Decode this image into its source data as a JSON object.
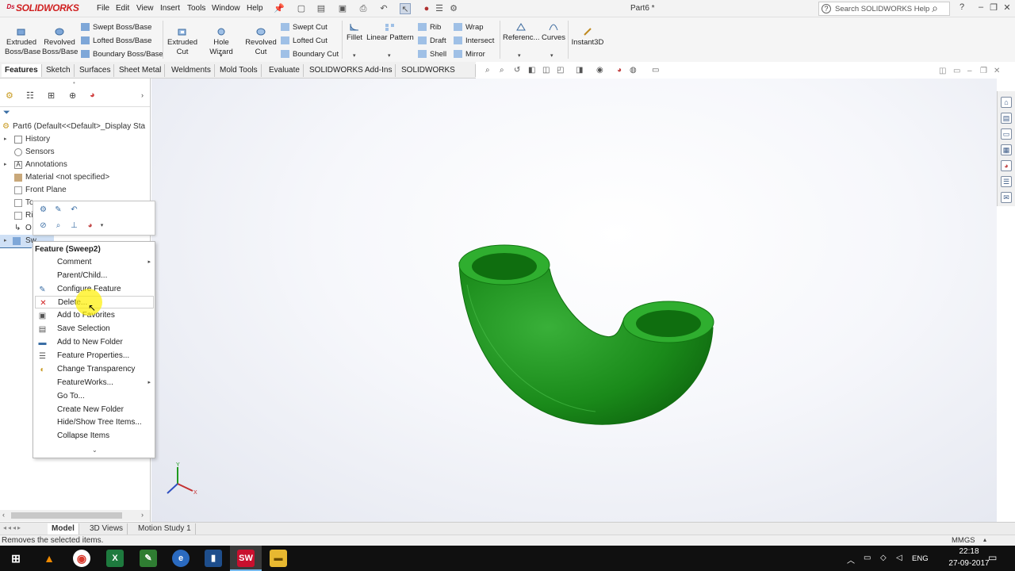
{
  "app": {
    "name": "SOLIDWORKS",
    "doc_title": "Part6 *"
  },
  "menu": [
    "File",
    "Edit",
    "View",
    "Insert",
    "Tools",
    "Window",
    "Help"
  ],
  "search": {
    "placeholder": "Search SOLIDWORKS Help"
  },
  "cmd": {
    "extruded_boss": "Extruded Boss/Base",
    "revolved_boss": "Revolved Boss/Base",
    "swept_boss": "Swept Boss/Base",
    "lofted_boss": "Lofted Boss/Base",
    "boundary_boss": "Boundary Boss/Base",
    "extruded_cut": "Extruded Cut",
    "hole_wizard": "Hole Wizard",
    "revolved_cut": "Revolved Cut",
    "swept_cut": "Swept Cut",
    "lofted_cut": "Lofted Cut",
    "boundary_cut": "Boundary Cut",
    "fillet": "Fillet",
    "linear_pattern": "Linear Pattern",
    "rib": "Rib",
    "draft": "Draft",
    "shell": "Shell",
    "wrap": "Wrap",
    "intersect": "Intersect",
    "mirror": "Mirror",
    "reference": "Referenc...",
    "curves": "Curves",
    "instant3d": "Instant3D"
  },
  "tabs": [
    "Features",
    "Sketch",
    "Surfaces",
    "Sheet Metal",
    "Weldments",
    "Mold Tools",
    "Evaluate",
    "SOLIDWORKS Add-Ins",
    "SOLIDWORKS MBD"
  ],
  "tree": {
    "part": "Part6  (Default<<Default>_Display Sta",
    "history": "History",
    "sensors": "Sensors",
    "annotations": "Annotations",
    "material": "Material <not specified>",
    "front_plane": "Front Plane",
    "top_plane_trunc": "To",
    "right_plane_trunc": "Ri",
    "origin_trunc": "O",
    "sweep_trunc": "Sw"
  },
  "context_menu": {
    "title": "Feature (Sweep2)",
    "items": [
      {
        "label": "Comment",
        "submenu": true
      },
      {
        "label": "Parent/Child..."
      },
      {
        "label": "Configure Feature"
      },
      {
        "label": "Delete..."
      },
      {
        "label": "Add to Favorites"
      },
      {
        "label": "Save Selection"
      },
      {
        "label": "Add to New Folder"
      },
      {
        "label": "Feature Properties..."
      },
      {
        "label": "Change Transparency"
      },
      {
        "label": "FeatureWorks...",
        "submenu": true
      },
      {
        "label": "Go To..."
      },
      {
        "label": "Create New Folder"
      },
      {
        "label": "Hide/Show Tree Items..."
      },
      {
        "label": "Collapse Items"
      }
    ]
  },
  "bottom_tabs": [
    "Model",
    "3D Views",
    "Motion Study 1"
  ],
  "status": {
    "text": "Removes the selected items.",
    "units": "MMGS"
  },
  "taskbar": {
    "lang": "ENG",
    "time": "22:18",
    "date": "27-09-2017"
  },
  "colors": {
    "part_green": "#2e9b2e",
    "accent_red": "#c8102e"
  }
}
